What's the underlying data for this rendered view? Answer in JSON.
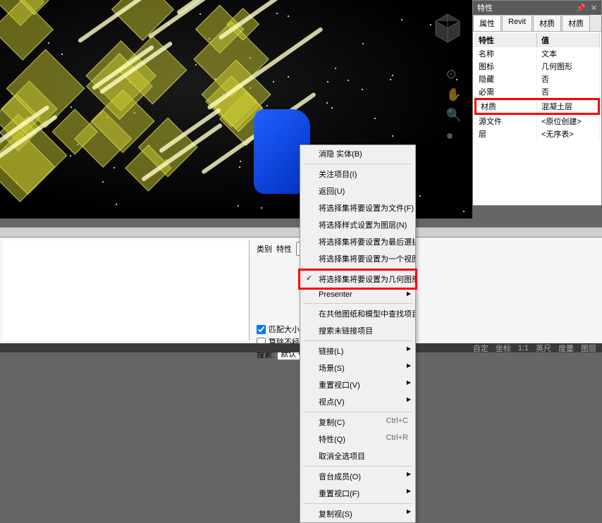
{
  "propPanel": {
    "title": "特性",
    "tabs": [
      "属性",
      "Revit",
      "材质",
      "材质"
    ],
    "header": {
      "col1": "特性",
      "col2": "值"
    },
    "rows": [
      {
        "k": "名称",
        "v": "文本"
      },
      {
        "k": "图标",
        "v": "几何图形"
      },
      {
        "k": "隐藏",
        "v": "否"
      },
      {
        "k": "必需",
        "v": "否"
      },
      {
        "k": "材质",
        "v": "混凝土层"
      },
      {
        "k": "源文件",
        "v": "<原位创建>"
      },
      {
        "k": "层",
        "v": "<无序表>"
      }
    ]
  },
  "menu": {
    "items": [
      {
        "label": "消隐 实体(B)",
        "type": "item"
      },
      {
        "type": "sep"
      },
      {
        "label": "关注项目(I)",
        "type": "item"
      },
      {
        "label": "返回(U)",
        "type": "item"
      },
      {
        "label": "将选择集将要设置为文件(F)",
        "type": "item"
      },
      {
        "label": "将选择样式设置为图层(N)",
        "type": "item"
      },
      {
        "label": "将选择集将要设置为最后選択的対象(F)",
        "type": "item"
      },
      {
        "label": "将选择集将要设置为一个视图(W)",
        "type": "item"
      },
      {
        "type": "sep"
      },
      {
        "label": "将选择集将要设置为几何图形(G)",
        "type": "item",
        "checked": true,
        "hl": true
      },
      {
        "label": "Presenter",
        "type": "sub"
      },
      {
        "type": "sep"
      },
      {
        "label": "在共他图纸和模型中查找项目(I)",
        "type": "item"
      },
      {
        "label": "搜索未链接项目",
        "type": "item"
      },
      {
        "type": "sep"
      },
      {
        "label": "链接(L)",
        "type": "sub"
      },
      {
        "label": "场景(S)",
        "type": "sub"
      },
      {
        "label": "重置视口(V)",
        "type": "sub"
      },
      {
        "label": "视点(V)",
        "type": "sub"
      },
      {
        "type": "sep"
      },
      {
        "label": "复制(C)",
        "type": "item",
        "sc": "Ctrl+C"
      },
      {
        "label": "特性(Q)",
        "type": "item",
        "sc": "Ctrl+R"
      },
      {
        "label": "取消全选项目",
        "type": "item"
      },
      {
        "type": "sep"
      },
      {
        "label": "音台成员(O)",
        "type": "sub"
      },
      {
        "label": "重置视口(F)",
        "type": "sub"
      },
      {
        "type": "sep"
      },
      {
        "label": "复制视(S)",
        "type": "sub"
      }
    ]
  },
  "lower": {
    "filterLabel": "类别",
    "filterBtn": "特性",
    "selOptions": [
      "类别"
    ],
    "chk1": "匹配大小写",
    "chk2": "算除不经常的结果",
    "searchLabel": "搜索:",
    "searchSel": "默认"
  },
  "footer": {
    "items": [
      "自定",
      "坐标",
      "1:1",
      "英尺",
      "度量",
      "图层"
    ]
  }
}
